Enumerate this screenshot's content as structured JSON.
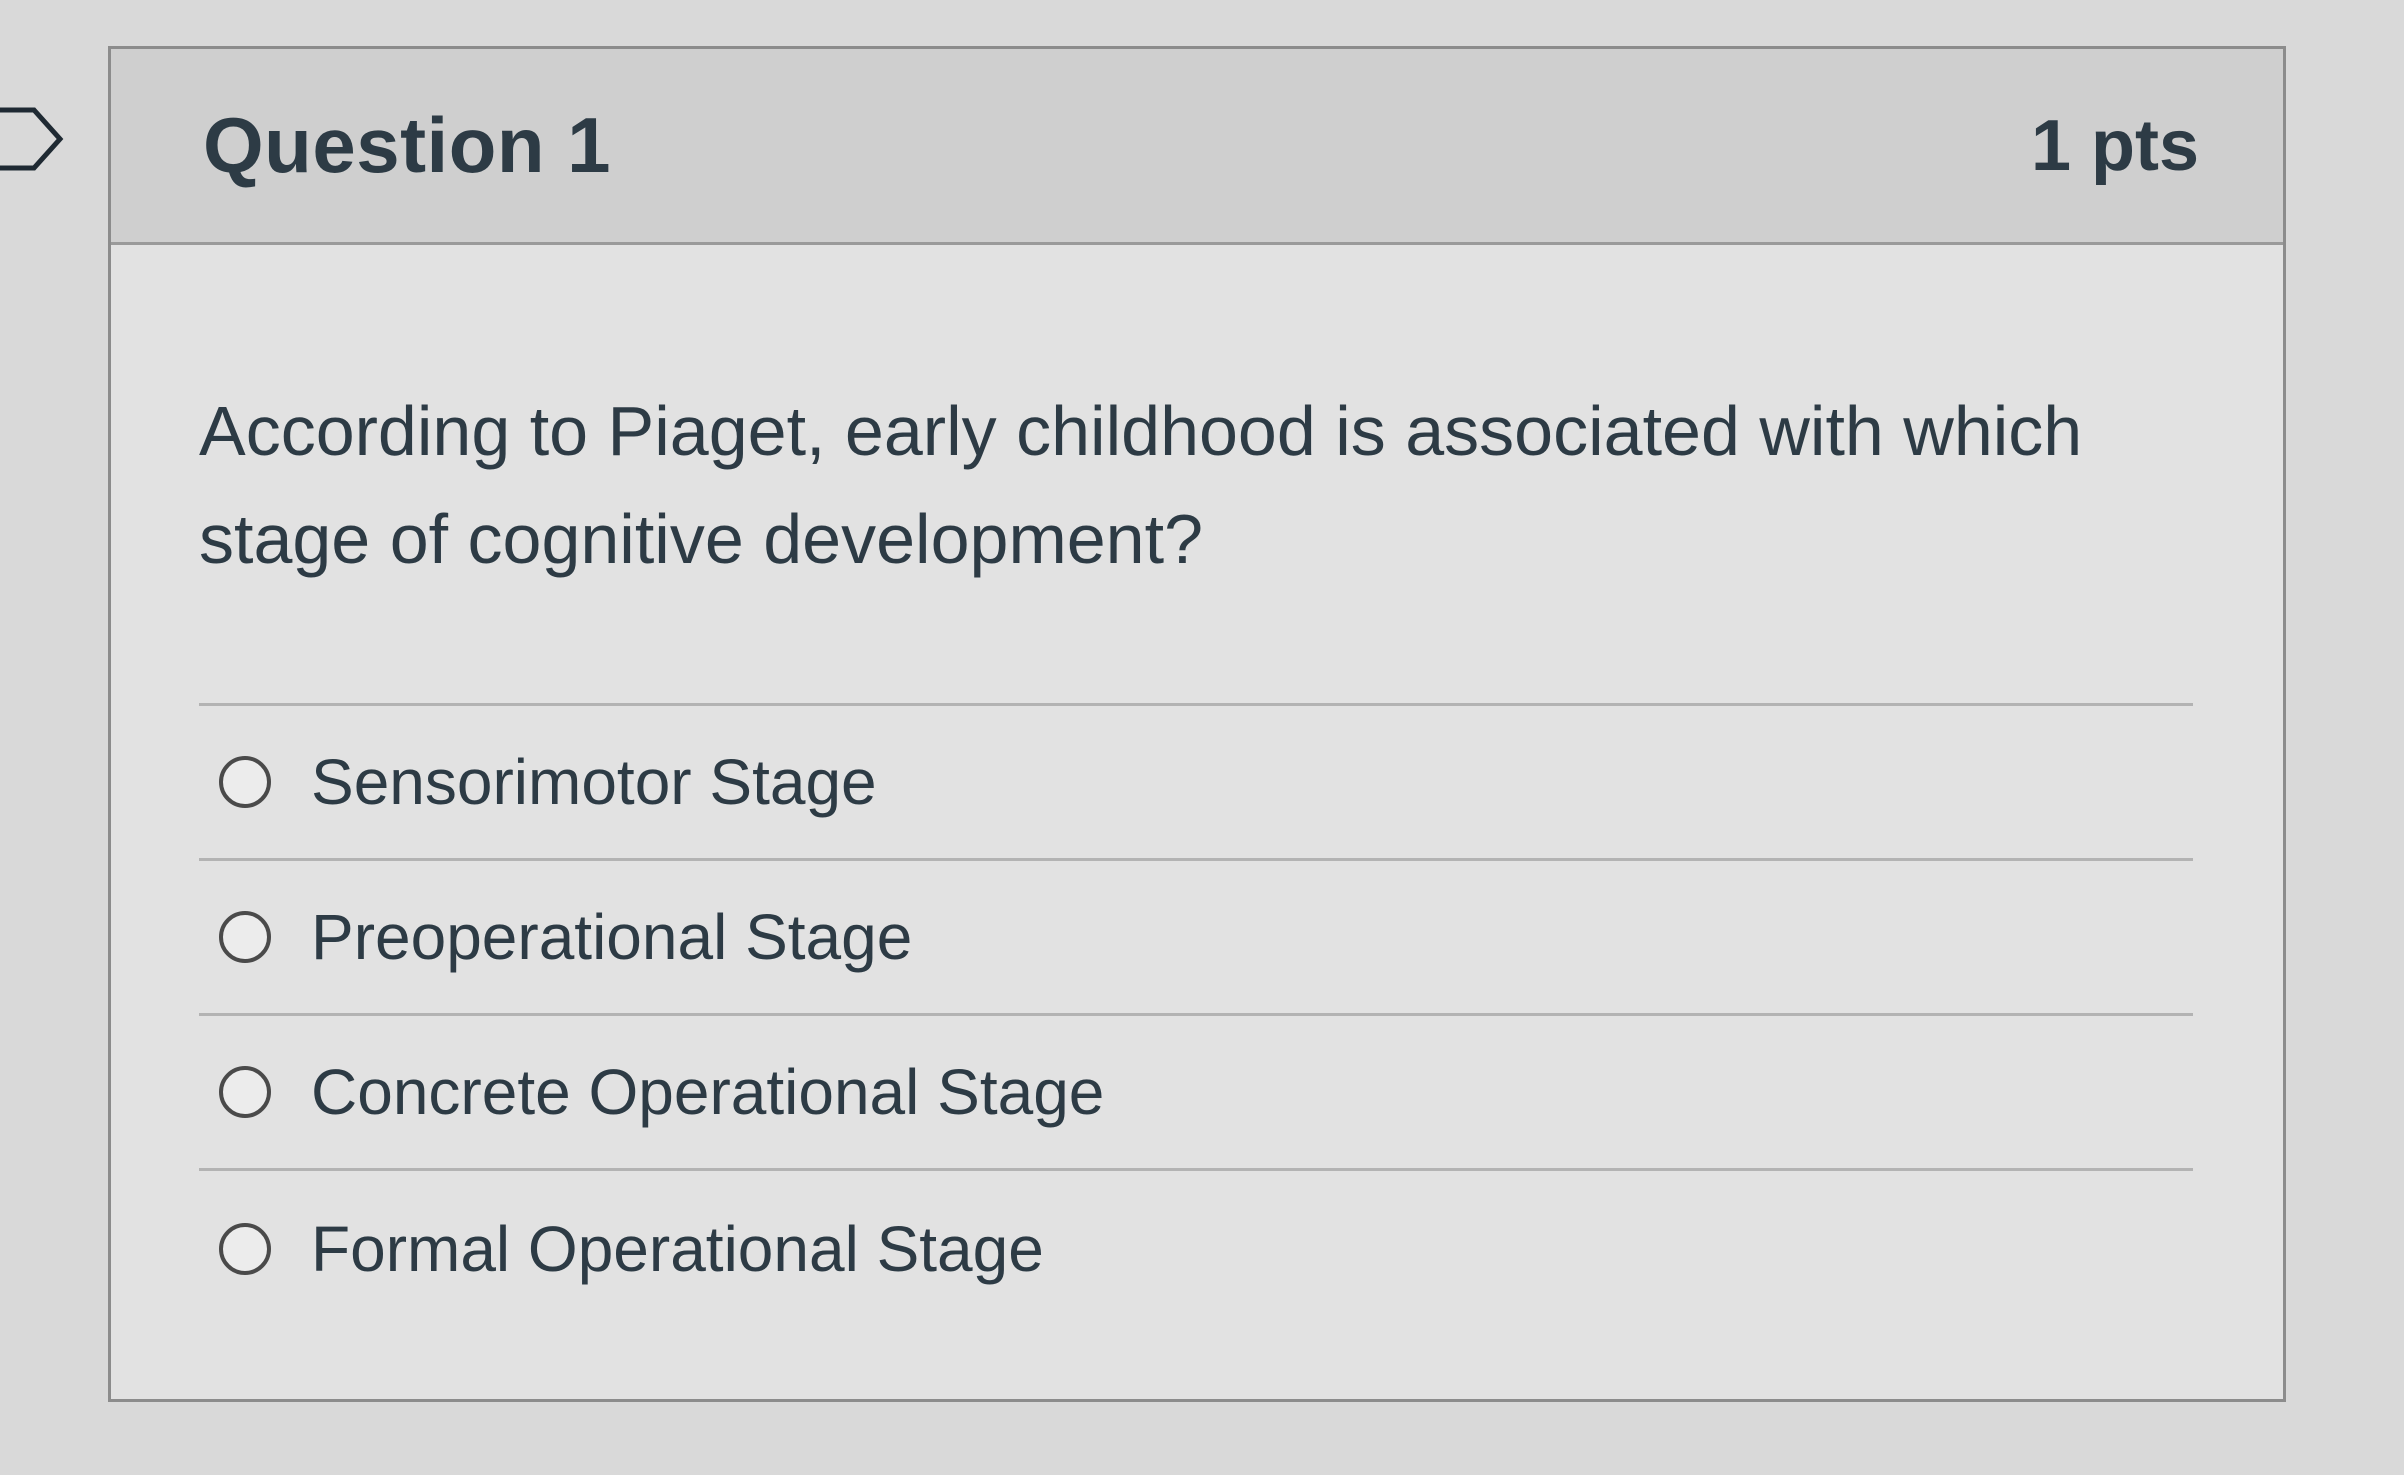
{
  "question": {
    "title": "Question 1",
    "points": "1 pts",
    "text": "According to Piaget, early childhood is associated with which stage of cognitive development?"
  },
  "answers": [
    {
      "label": "Sensorimotor Stage",
      "selected": false
    },
    {
      "label": "Preoperational Stage",
      "selected": false
    },
    {
      "label": "Concrete Operational Stage",
      "selected": false
    },
    {
      "label": "Formal Operational Stage",
      "selected": false
    }
  ],
  "colors": {
    "text": "#2d3b45",
    "header_background": "#cfcfcf",
    "body_background": "#e2e2e2",
    "border": "#8c8c8c"
  },
  "icons": {
    "flag": "bookmark-flag-icon",
    "radio": "radio-button-icon"
  }
}
